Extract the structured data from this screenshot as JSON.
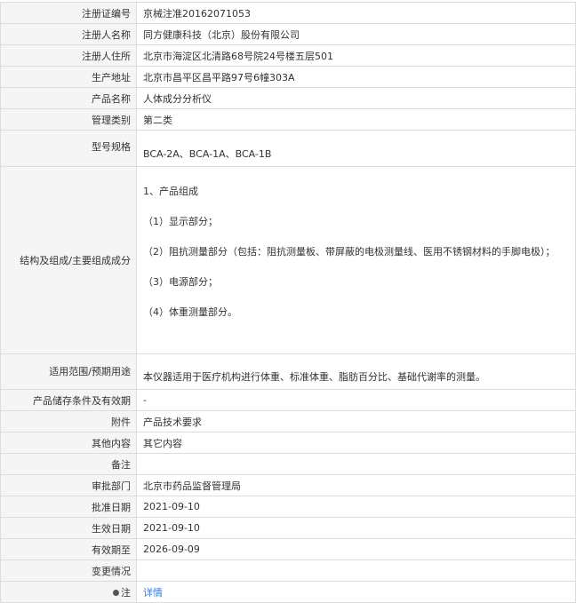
{
  "rows": {
    "reg_no": {
      "label": "注册证编号",
      "value": "京械注准20162071053"
    },
    "registrant": {
      "label": "注册人名称",
      "value": "同方健康科技（北京）股份有限公司"
    },
    "address": {
      "label": "注册人住所",
      "value": "北京市海淀区北清路68号院24号楼五层501"
    },
    "production_address": {
      "label": "生产地址",
      "value": "北京市昌平区昌平路97号6幢303A"
    },
    "product_name": {
      "label": "产品名称",
      "value": "人体成分分析仪"
    },
    "category": {
      "label": "管理类别",
      "value": "第二类"
    },
    "model": {
      "label": "型号规格",
      "value": "BCA-2A、BCA-1A、BCA-1B"
    },
    "structure": {
      "label": "结构及组成/主要组成成分",
      "lines": [
        "1、产品组成",
        "（1）显示部分；",
        "（2）阻抗测量部分（包括：阻抗测量板、带屏蔽的电极测量线、医用不锈钢材料的手脚电极）；",
        "（3）电源部分；",
        "（4）体重测量部分。"
      ]
    },
    "intended_use": {
      "label": "适用范围/预期用途",
      "value": "本仪器适用于医疗机构进行体重、标准体重、脂肪百分比、基础代谢率的测量。"
    },
    "storage": {
      "label": "产品储存条件及有效期",
      "value": "-"
    },
    "attachment": {
      "label": "附件",
      "value": "产品技术要求"
    },
    "other": {
      "label": "其他内容",
      "value": "其它内容"
    },
    "remark": {
      "label": "备注",
      "value": ""
    },
    "approval_dept": {
      "label": "审批部门",
      "value": "北京市药品监督管理局"
    },
    "approval_date": {
      "label": "批准日期",
      "value": "2021-09-10"
    },
    "effective_date": {
      "label": "生效日期",
      "value": "2021-09-10"
    },
    "expiry_date": {
      "label": "有效期至",
      "value": "2026-09-09"
    },
    "changes": {
      "label": "变更情况",
      "value": ""
    },
    "note": {
      "label": "注",
      "value": "详情"
    }
  }
}
